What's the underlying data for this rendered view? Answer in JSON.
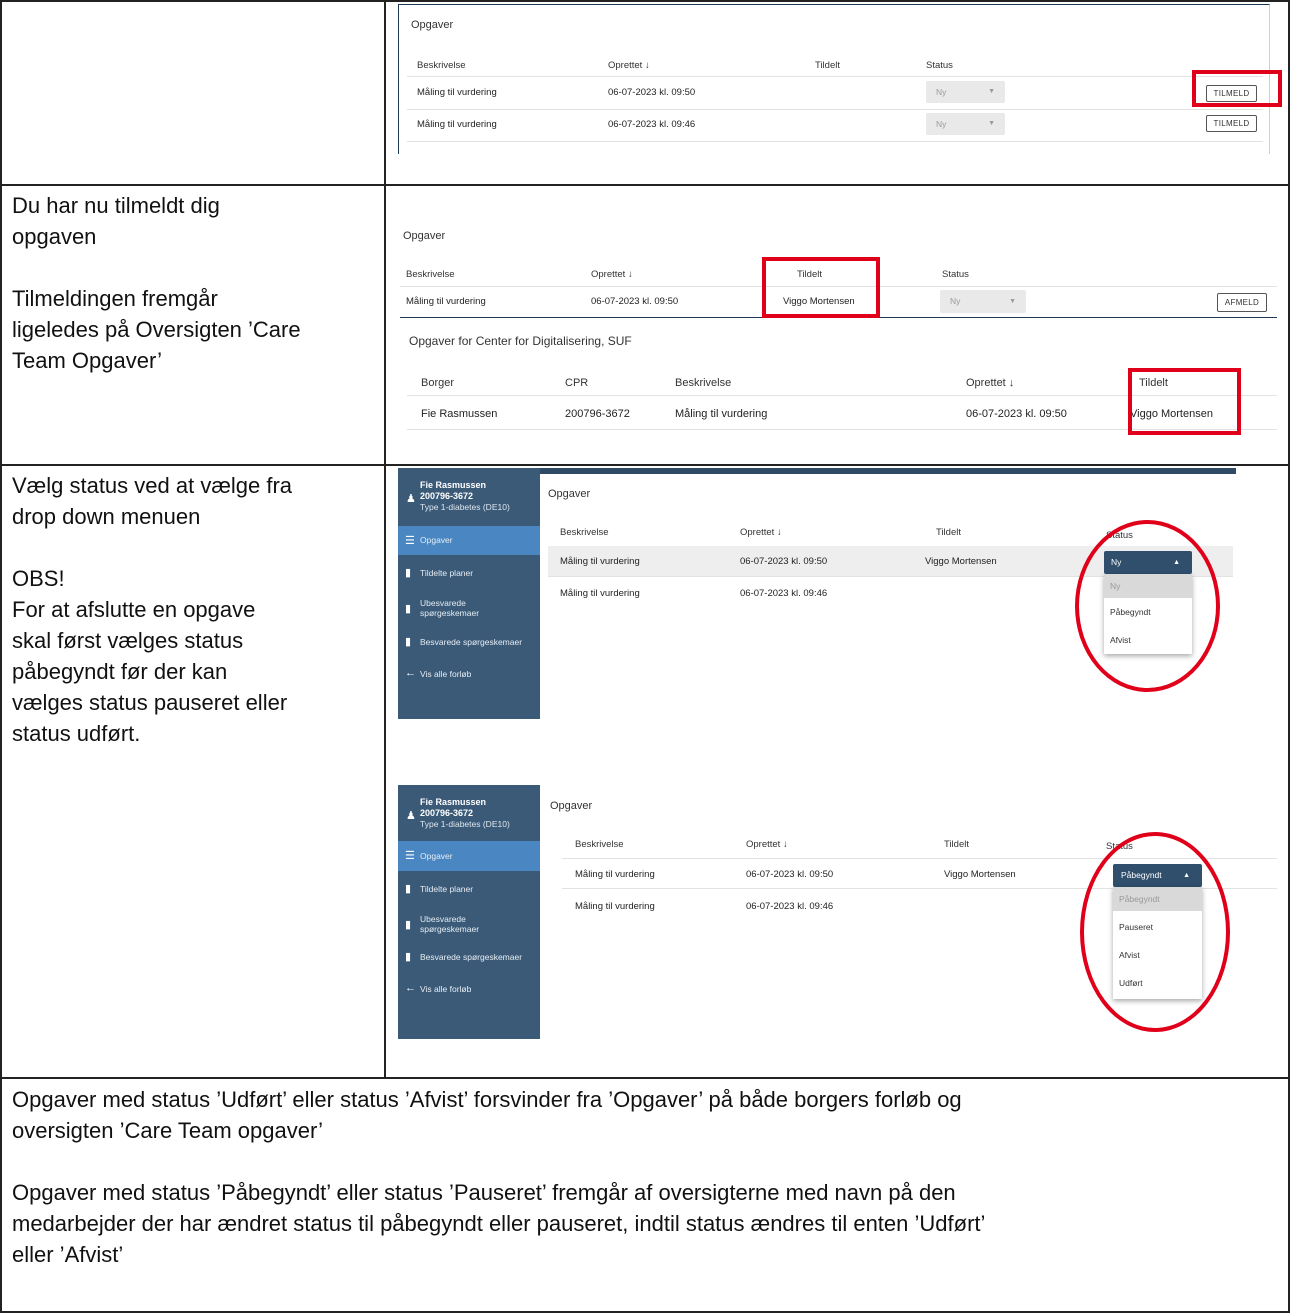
{
  "rows": {
    "row2_text": [
      "Du har nu tilmeldt dig",
      "opgaven",
      "Tilmeldingen fremgår",
      "ligeledes på Oversigten ’Care",
      "Team Opgaver’"
    ],
    "row3_text": [
      "Vælg status ved at vælge fra",
      "drop down menuen",
      "OBS!",
      "For at afslutte en opgave",
      "skal først vælges status",
      "påbegyndt før der kan",
      "vælges status pauseret eller",
      "status udført."
    ],
    "footer_p1": [
      "Opgaver med status ’Udført’ eller status ’Afvist’ forsvinder fra ’Opgaver’ på både borgers forløb og",
      "oversigten ’Care Team opgaver’"
    ],
    "footer_p2": [
      "Opgaver med status ’Påbegyndt’ eller status ’Pauseret’ fremgår af oversigterne med navn på den",
      "medarbejder der har ændret status til påbegyndt eller pauseret, indtil status ændres til enten ’Udført’",
      "eller ’Afvist’"
    ]
  },
  "shot1": {
    "title": "Opgaver",
    "headers": [
      "Beskrivelse",
      "Oprettet ↓",
      "Tildelt",
      "Status"
    ],
    "rows": [
      {
        "desc": "Måling til vurdering",
        "created": "06-07-2023 kl. 09:50",
        "status": "Ny",
        "button": "TILMELD"
      },
      {
        "desc": "Måling til vurdering",
        "created": "06-07-2023 kl. 09:46",
        "status": "Ny",
        "button": "TILMELD"
      }
    ]
  },
  "shot2": {
    "title": "Opgaver",
    "headers": [
      "Beskrivelse",
      "Oprettet ↓",
      "Tildelt",
      "Status"
    ],
    "row": {
      "desc": "Måling til vurdering",
      "created": "06-07-2023 kl. 09:50",
      "assigned": "Viggo Mortensen",
      "status": "Ny",
      "button": "AFMELD"
    },
    "overview_title": "Opgaver for Center for Digitalisering, SUF",
    "overview_headers": [
      "Borger",
      "CPR",
      "Beskrivelse",
      "Oprettet ↓",
      "Tildelt"
    ],
    "overview_row": {
      "citizen": "Fie Rasmussen",
      "cpr": "200796-3672",
      "desc": "Måling til vurdering",
      "created": "06-07-2023 kl. 09:50",
      "assigned": "Viggo Mortensen"
    }
  },
  "sidebar": {
    "name": "Fie Rasmussen",
    "cpr": "200796-3672",
    "diagnosis": "Type 1-diabetes (DE10)",
    "items": [
      "Opgaver",
      "Tildelte planer",
      "Ubesvarede",
      "spørgeskemaer",
      "Besvarede spørgeskemaer",
      "Vis alle forløb"
    ]
  },
  "shot3": {
    "title": "Opgaver",
    "headers": [
      "Beskrivelse",
      "Oprettet ↓",
      "Tildelt",
      "Status"
    ],
    "rows": [
      {
        "desc": "Måling til vurdering",
        "created": "06-07-2023 kl. 09:50",
        "assigned": "Viggo Mortensen"
      },
      {
        "desc": "Måling til vurdering",
        "created": "06-07-2023 kl. 09:46",
        "assigned": ""
      }
    ],
    "dropdown_value": "Ny",
    "options": [
      "Ny",
      "Påbegyndt",
      "Afvist"
    ]
  },
  "shot4": {
    "title": "Opgaver",
    "headers": [
      "Beskrivelse",
      "Oprettet ↓",
      "Tildelt",
      "Status"
    ],
    "rows": [
      {
        "desc": "Måling til vurdering",
        "created": "06-07-2023 kl. 09:50",
        "assigned": "Viggo Mortensen"
      },
      {
        "desc": "Måling til vurdering",
        "created": "06-07-2023 kl. 09:46",
        "assigned": ""
      }
    ],
    "dropdown_value": "Påbegyndt",
    "options": [
      "Påbegyndt",
      "Pauseret",
      "Afvist",
      "Udført"
    ]
  },
  "colors": {
    "accent_red": "#e0001a",
    "sidebar_bg": "#3a5a78",
    "sidebar_active": "#4a86c2",
    "dropdown_bg": "#2f4f6d"
  }
}
